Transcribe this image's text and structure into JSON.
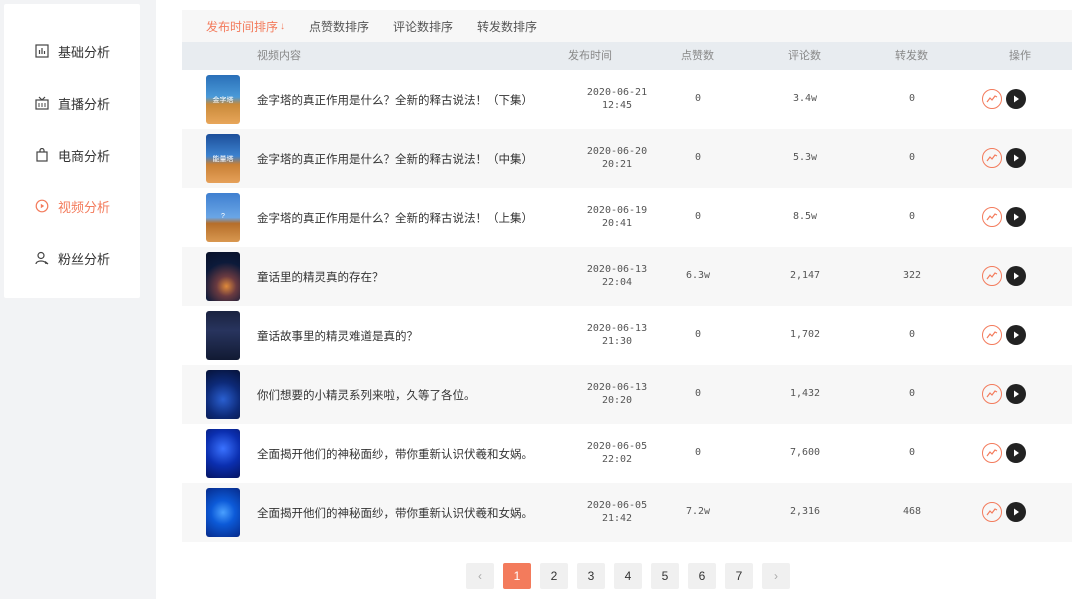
{
  "sidebar": {
    "items": [
      {
        "label": "基础分析",
        "icon": "bar-chart-icon",
        "active": false
      },
      {
        "label": "直播分析",
        "icon": "live-icon",
        "active": false
      },
      {
        "label": "电商分析",
        "icon": "shopping-bag-icon",
        "active": false
      },
      {
        "label": "视频分析",
        "icon": "play-circle-icon",
        "active": true
      },
      {
        "label": "粉丝分析",
        "icon": "user-icon",
        "active": false
      }
    ]
  },
  "sort_tabs": [
    {
      "label": "发布时间排序",
      "active": true
    },
    {
      "label": "点赞数排序",
      "active": false
    },
    {
      "label": "评论数排序",
      "active": false
    },
    {
      "label": "转发数排序",
      "active": false
    }
  ],
  "table": {
    "headers": {
      "content": "视频内容",
      "time": "发布时间",
      "likes": "点赞数",
      "comments": "评论数",
      "shares": "转发数",
      "ops": "操作"
    },
    "rows": [
      {
        "title": "金字塔的真正作用是什么？全新的释古说法！（下集）",
        "date": "2020-06-21",
        "time": "12:45",
        "likes": "0",
        "comments": "3.4w",
        "shares": "0",
        "thumb_text": "金字塔"
      },
      {
        "title": "金字塔的真正作用是什么？全新的释古说法！（中集）",
        "date": "2020-06-20",
        "time": "20:21",
        "likes": "0",
        "comments": "5.3w",
        "shares": "0",
        "thumb_text": "能量塔"
      },
      {
        "title": "金字塔的真正作用是什么？全新的释古说法！（上集）",
        "date": "2020-06-19",
        "time": "20:41",
        "likes": "0",
        "comments": "8.5w",
        "shares": "0",
        "thumb_text": "?"
      },
      {
        "title": "童话里的精灵真的存在？",
        "date": "2020-06-13",
        "time": "22:04",
        "likes": "6.3w",
        "comments": "2,147",
        "shares": "322",
        "thumb_text": ""
      },
      {
        "title": "童话故事里的精灵难道是真的？",
        "date": "2020-06-13",
        "time": "21:30",
        "likes": "0",
        "comments": "1,702",
        "shares": "0",
        "thumb_text": ""
      },
      {
        "title": "你们想要的小精灵系列来啦，久等了各位。",
        "date": "2020-06-13",
        "time": "20:20",
        "likes": "0",
        "comments": "1,432",
        "shares": "0",
        "thumb_text": ""
      },
      {
        "title": "全面揭开他们的神秘面纱，带你重新认识伏羲和女娲。",
        "date": "2020-06-05",
        "time": "22:02",
        "likes": "0",
        "comments": "7,600",
        "shares": "0",
        "thumb_text": ""
      },
      {
        "title": "全面揭开他们的神秘面纱，带你重新认识伏羲和女娲。",
        "date": "2020-06-05",
        "time": "21:42",
        "likes": "7.2w",
        "comments": "2,316",
        "shares": "468",
        "thumb_text": ""
      }
    ]
  },
  "pagination": {
    "prev": "‹",
    "next": "›",
    "pages": [
      "1",
      "2",
      "3",
      "4",
      "5",
      "6",
      "7"
    ],
    "current": "1"
  },
  "colors": {
    "accent": "#f37b5c"
  }
}
